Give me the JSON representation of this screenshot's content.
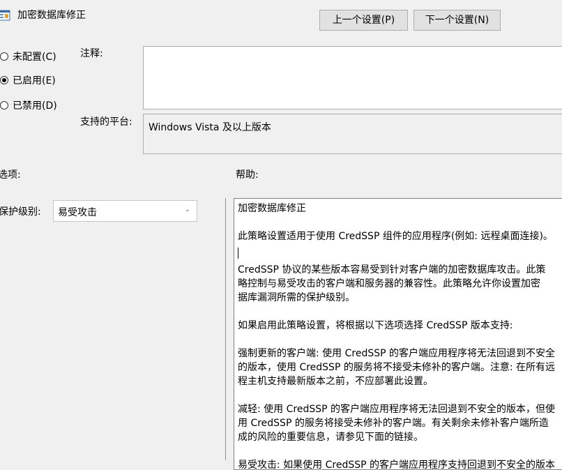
{
  "window": {
    "title": "加密数据库修正"
  },
  "nav": {
    "prev": "上一个设置(P)",
    "next": "下一个设置(N)"
  },
  "state": {
    "options": [
      {
        "label": "未配置(C)",
        "checked": false
      },
      {
        "label": "已启用(E)",
        "checked": true
      },
      {
        "label": "已禁用(D)",
        "checked": false
      }
    ]
  },
  "comment": {
    "label": "注释:",
    "value": ""
  },
  "platform": {
    "label": "支持的平台:",
    "value": "Windows Vista 及以上版本"
  },
  "sections": {
    "options": "选项:",
    "help": "帮助:"
  },
  "protection": {
    "label": "保护级别:",
    "value": "易受攻击"
  },
  "help": {
    "paragraphs": [
      "加密数据库修正",
      "此策略设置适用于使用 CredSSP 组件的应用程序(例如: 远程桌面连接)。",
      "CredSSP 协议的某些版本容易受到针对客户端的加密数据库攻击。此策\n略控制与易受攻击的客户端和服务器的兼容性。此策略允许你设置加密\n据库漏洞所需的保护级别。",
      "如果启用此策略设置，将根据以下选项选择 CredSSP 版本支持:",
      "强制更新的客户端: 使用 CredSSP 的客户端应用程序将无法回退到不安全\n的版本，使用 CredSSP 的服务将不接受未修补的客户端。注意: 在所有远\n程主机支持最新版本之前，不应部署此设置。",
      "减轻: 使用 CredSSP 的客户端应用程序将无法回退到不安全的版本，但使\n用 CredSSP 的服务将接受未修补的客户端。有关剩余未修补客户端所造\n成的风险的重要信息，请参见下面的链接。",
      "易受攻击: 如果使用 CredSSP 的客户端应用程序支持回退到不安全的版本"
    ]
  }
}
